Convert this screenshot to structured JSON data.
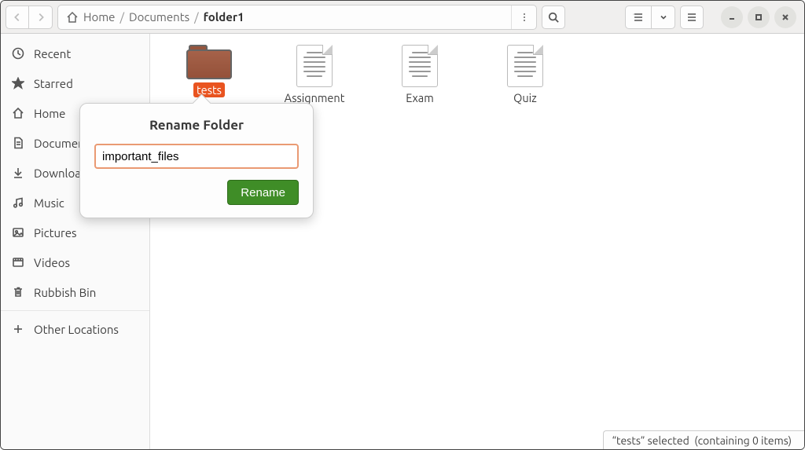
{
  "path": {
    "segments": [
      "Home",
      "Documents",
      "folder1"
    ],
    "active_index": 2
  },
  "sidebar": {
    "items": [
      {
        "id": "recent",
        "label": "Recent",
        "icon": "clock"
      },
      {
        "id": "starred",
        "label": "Starred",
        "icon": "star"
      },
      {
        "id": "home",
        "label": "Home",
        "icon": "home"
      },
      {
        "id": "documents",
        "label": "Documents",
        "icon": "document"
      },
      {
        "id": "downloads",
        "label": "Downloads",
        "icon": "download"
      },
      {
        "id": "music",
        "label": "Music",
        "icon": "music"
      },
      {
        "id": "pictures",
        "label": "Pictures",
        "icon": "picture"
      },
      {
        "id": "videos",
        "label": "Videos",
        "icon": "video"
      },
      {
        "id": "trash",
        "label": "Rubbish Bin",
        "icon": "trash"
      }
    ],
    "other_label": "Other Locations"
  },
  "files": {
    "items": [
      {
        "name": "tests",
        "type": "folder",
        "selected": true
      },
      {
        "name": "Assignment",
        "type": "file",
        "selected": false
      },
      {
        "name": "Exam",
        "type": "file",
        "selected": false
      },
      {
        "name": "Quiz",
        "type": "file",
        "selected": false
      }
    ]
  },
  "rename_dialog": {
    "title": "Rename Folder",
    "value": "important_files",
    "button": "Rename"
  },
  "status": {
    "text": "“tests” selected  (containing 0 items)"
  }
}
